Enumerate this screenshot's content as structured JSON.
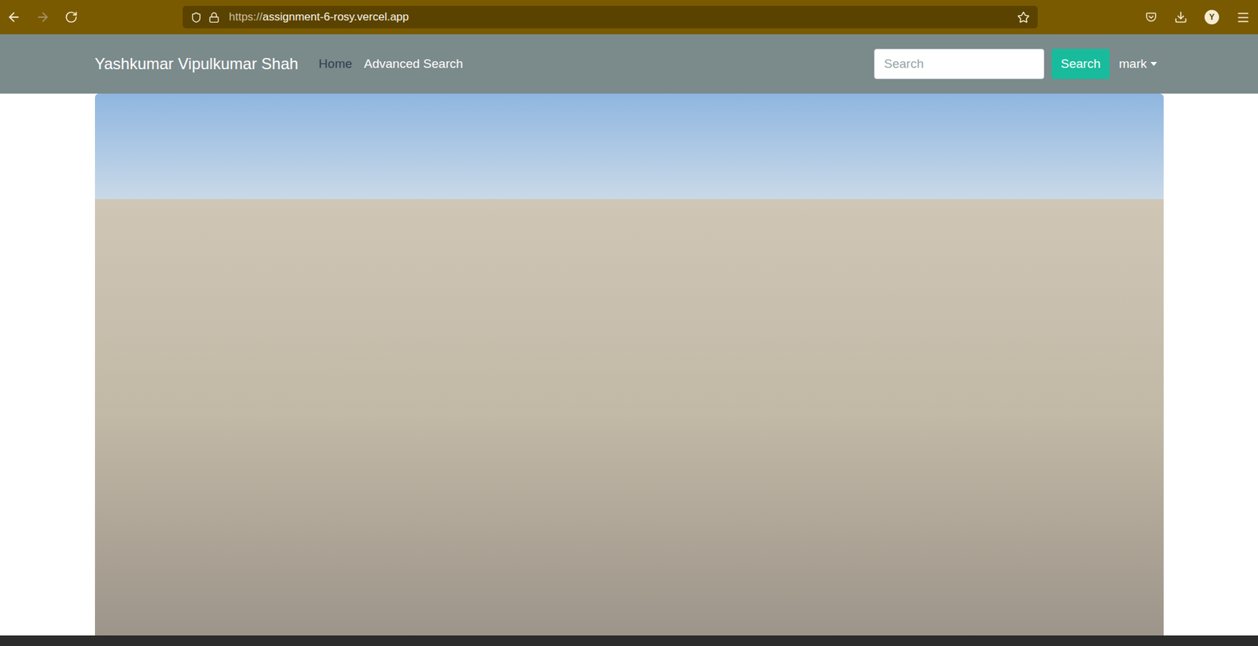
{
  "browser": {
    "url_scheme": "https://",
    "url_host": "assignment-6-rosy.vercel.app",
    "profile_initial": "Y",
    "back_enabled": true,
    "forward_enabled": false,
    "bookmarked": false
  },
  "navbar": {
    "brand": "Yashkumar Vipulkumar Shah",
    "links": [
      {
        "label": "Home",
        "selected": true
      },
      {
        "label": "Advanced Search",
        "selected": false
      }
    ],
    "search": {
      "placeholder": "Search"
    },
    "search_button": "Search",
    "user_menu": "mark"
  }
}
